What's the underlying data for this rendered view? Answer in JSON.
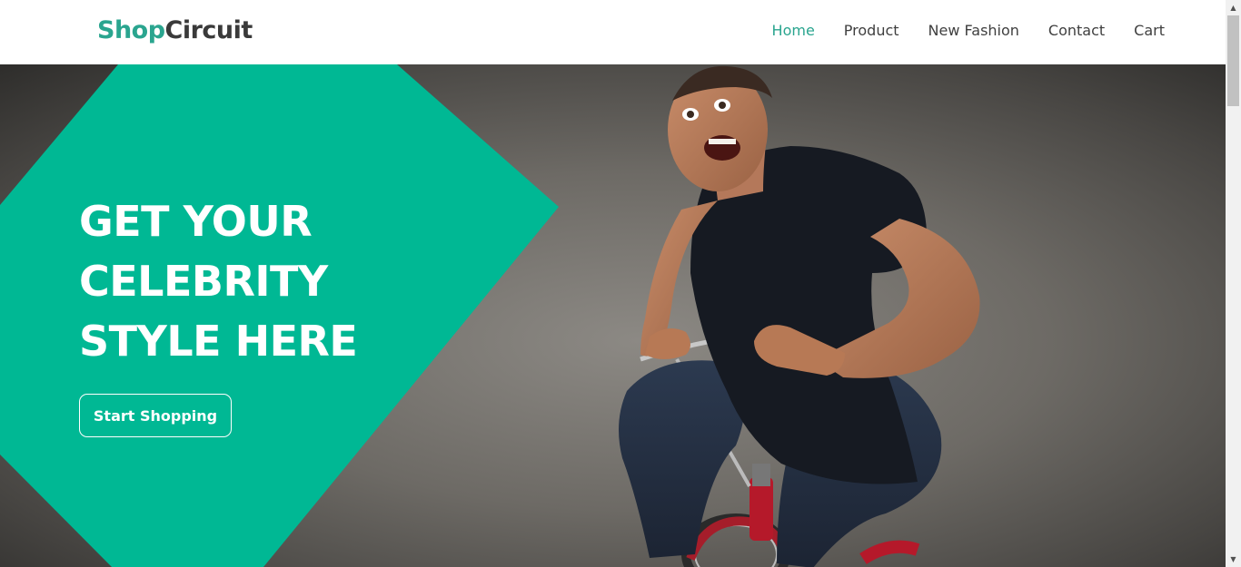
{
  "header": {
    "brand_part1": "Shop",
    "brand_part2": "Circuit",
    "nav": [
      {
        "label": "Home",
        "active": true
      },
      {
        "label": "Product",
        "active": false
      },
      {
        "label": "New Fashion",
        "active": false
      },
      {
        "label": "Contact",
        "active": false
      },
      {
        "label": "Cart",
        "active": false
      }
    ]
  },
  "hero": {
    "headline_lines": [
      "GET YOUR",
      "CELEBRITY",
      "STYLE HERE"
    ],
    "cta_label": "Start Shopping",
    "image_icon": "man-on-tricycle-photo"
  },
  "colors": {
    "accent": "#2aa58f",
    "shape": "#00b894",
    "text_dark": "#3f3f3f"
  },
  "scrollbar": {
    "up_icon": "scroll-up-arrow-icon",
    "down_icon": "scroll-down-arrow-icon"
  }
}
